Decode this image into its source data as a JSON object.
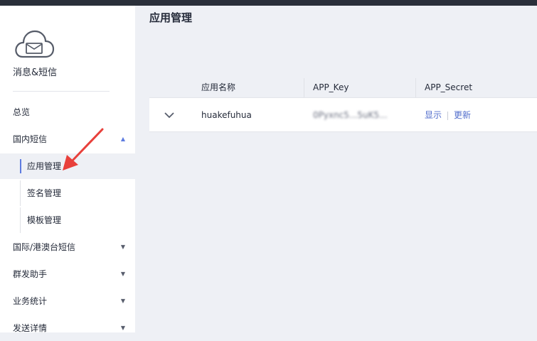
{
  "sidebar": {
    "app_name": "消息&短信",
    "nav": [
      {
        "label": "总览"
      },
      {
        "label": "国内短信"
      },
      {
        "label": "国际/港澳台短信"
      },
      {
        "label": "群发助手"
      },
      {
        "label": "业务统计"
      },
      {
        "label": "发送详情"
      }
    ],
    "sub_items": [
      {
        "label": "应用管理",
        "active": true
      },
      {
        "label": "签名管理"
      },
      {
        "label": "模板管理"
      }
    ]
  },
  "main": {
    "title": "应用管理",
    "table": {
      "columns": [
        "应用名称",
        "APP_Key",
        "APP_Secret"
      ],
      "rows": [
        {
          "name": "huakefuhua",
          "app_key": "0Pyxnc5...5uK5...",
          "actions": [
            "显示",
            "更新"
          ]
        }
      ]
    }
  },
  "colors": {
    "accent": "#5e7ce0",
    "link": "#526ecc",
    "arrow_annotation": "#e8403b",
    "background": "#eef0f5"
  }
}
